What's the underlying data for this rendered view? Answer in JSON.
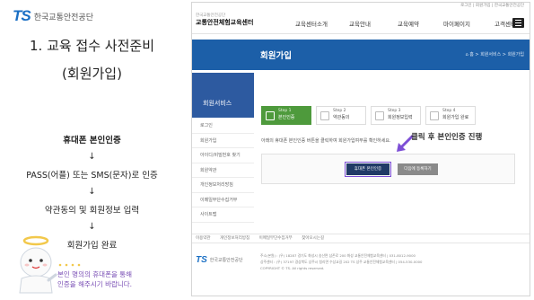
{
  "logo": {
    "mark": "TS",
    "name": "한국교통안전공단"
  },
  "heading": {
    "line1": "1.  교육 접수 사전준비",
    "line2": "(회원가입)"
  },
  "flow": {
    "step1": "휴대폰 본인인증",
    "arrow": "↓",
    "step2": "PASS(어플) 또는 SMS(문자)로 인증",
    "step3": "약관동의 및 회원정보 입력",
    "step4": "회원가입 완료"
  },
  "note": {
    "line1": "본인 명의의 휴대폰을 통해",
    "line2": "인증을 해주시기 바랍니다."
  },
  "screenshot": {
    "topbar": "로그인  |  회원가입  |  한국교통안전공단",
    "brand_small": "한국교통안전공단",
    "brand_name": "교통안전체험교육센터",
    "menu": [
      "교육센터소개",
      "교육안내",
      "교육예약",
      "마이페이지",
      "고객센터"
    ],
    "banner_title": "회원가입",
    "breadcrumb": "⌂ 홈  >  회원서비스  >  회원가입",
    "side_title": "회원서비스",
    "side_items": [
      "로그인",
      "회원가입",
      "아이디/비밀번호 찾기",
      "회원약관",
      "개인정보처리방침",
      "이메일무단수집거부",
      "사이트맵"
    ],
    "steps": [
      {
        "num": "Step 1",
        "name": "본인인증"
      },
      {
        "num": "Step 2",
        "name": "약관동의"
      },
      {
        "num": "Step 3",
        "name": "회원정보입력"
      },
      {
        "num": "Step 4",
        "name": "회원가입 완료"
      }
    ],
    "intro": "아래의 휴대폰 본인인증 버튼을 클릭하여 회원가입여부를 확인하세요.",
    "hint": "클릭 후 본인인증 진행",
    "btn_phone": "휴대폰 본인인증",
    "btn_next": "다음에 등록하기",
    "footer_links": [
      "이용약관",
      "개인정보처리방침",
      "이메일무단수집거부",
      "찾아오시는길"
    ],
    "footer_logo_mark": "TS",
    "footer_logo_name": "한국교통안전공단",
    "footer_addr1": "주소(본원) : (우) 18287 경기도 화성시 송산면 삼존로 200 화성 교통안전체험교육센터 | 031-8012-9000",
    "footer_addr2": "상주센터 : (우) 37197 경상북도 상주시 청리면 수상교길 202 TS 상주 교통안전체험교육센터 | 054-530-0000",
    "footer_copy": "COPYRIGHT © TS. All rights reserved."
  }
}
